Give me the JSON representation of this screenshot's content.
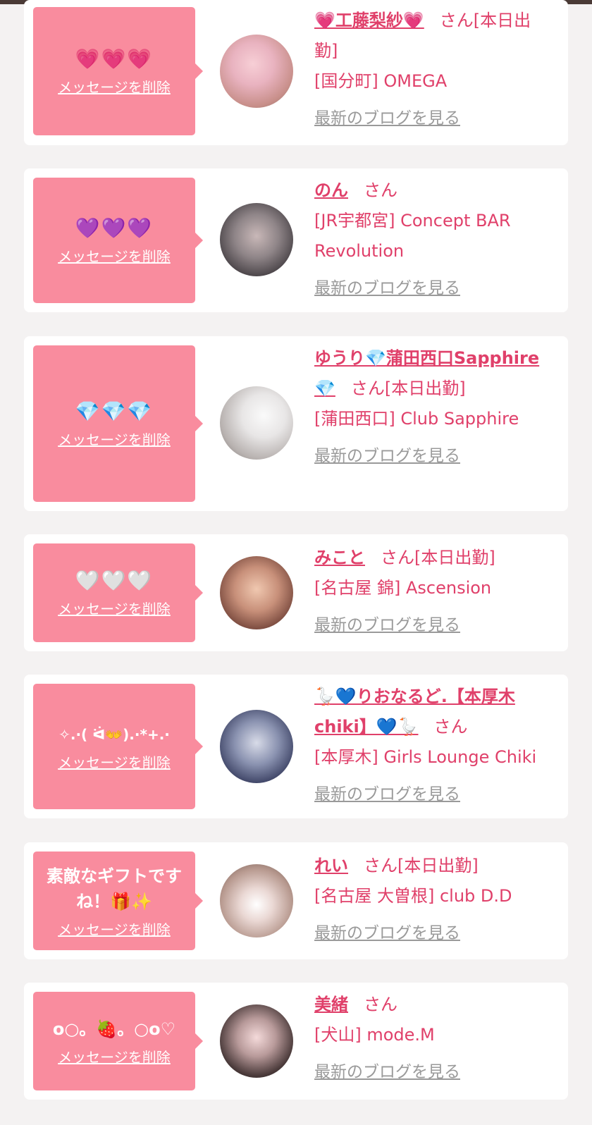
{
  "delete_label": "メッセージを削除",
  "san_label": "さん",
  "blog_link": "最新のブログを見る",
  "items": [
    {
      "message": "💗💗💗",
      "name": "💗工藤梨紗💗",
      "status": "[本日出勤]",
      "shop": "[国分町] OMEGA"
    },
    {
      "message": "💜💜💜",
      "name": "のん",
      "status": "",
      "shop": "[JR宇都宮] Concept BAR Revolution"
    },
    {
      "message": "💎💎💎",
      "name": "ゆうり💎蒲田西口Sapphire💎",
      "status": "[本日出勤]",
      "shop": "[蒲田西口] Club Sapphire"
    },
    {
      "message": "🤍🤍🤍",
      "name": "みこと",
      "status": "[本日出勤]",
      "shop": "[名古屋 錦] Ascension"
    },
    {
      "message": "✧.·( ᐛ👐).·*+.·",
      "name": "🪿💙りおなるど.【本厚木chiki】💙🪿",
      "status": "",
      "shop": "[本厚木] Girls Lounge Chiki"
    },
    {
      "message": "素敵なギフトですね！🎁✨",
      "name": "れい",
      "status": "[本日出勤]",
      "shop": "[名古屋 大曽根] club D.D"
    },
    {
      "message": "o○。🍓。○o♡",
      "name": "美緒",
      "status": "",
      "shop": "[犬山] mode.M"
    }
  ]
}
